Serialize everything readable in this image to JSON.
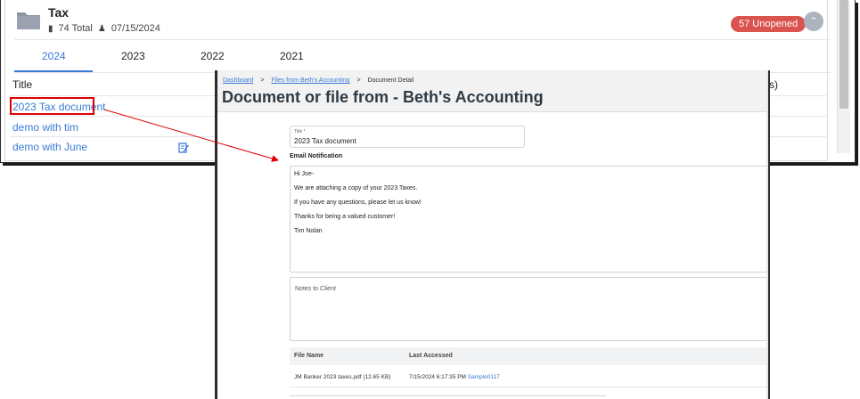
{
  "folder": {
    "name": "Tax",
    "total": "74 Total",
    "date": "07/15/2024",
    "unopened_badge": "57 Unopened"
  },
  "tabs": [
    "2024",
    "2023",
    "2022",
    "2021"
  ],
  "table": {
    "header_title": "Title",
    "header_right_partial": "s)",
    "rows": [
      "2023 Tax document",
      "demo with tim",
      "demo with June"
    ]
  },
  "detail": {
    "breadcrumb": [
      "Dashboard",
      "Files from Beth's Accounting",
      "Document Detail"
    ],
    "page_title": "Document or file from - Beth's Accounting",
    "title_label": "Title",
    "title_required": "*",
    "title_value": "2023 Tax document",
    "email_heading": "Email Notification",
    "email_lines": [
      "Hi Joe-",
      "We are attaching a copy of your 2023 Taxes.",
      "If you have any questions, please let us know!",
      "Thanks for being a valued customer!",
      "Tim Nolan"
    ],
    "notes_placeholder": "Notes to Client",
    "files_headers": [
      "File Name",
      "Last Accessed"
    ],
    "files_rows": [
      {
        "file_name": "JM Banker 2023 taxes.pdf (12.65 KB)",
        "last_accessed": "7/15/2024 6:17:35 PM",
        "user": "Sample0117"
      }
    ]
  },
  "icons": {
    "folder": "folder-icon",
    "file": "file-icon",
    "person": "person-icon",
    "chevron_up": "chevron-up-icon",
    "signature": "signature-icon"
  },
  "colors": {
    "link": "#3a7bd5",
    "badge": "#d9534f",
    "highlight": "#e00000"
  }
}
